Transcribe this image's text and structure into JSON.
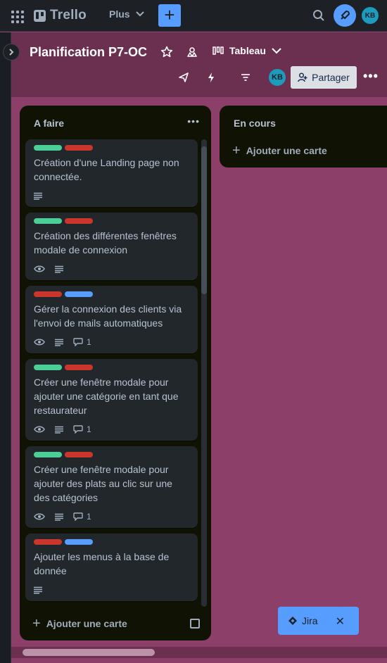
{
  "topnav": {
    "app_name": "Trello",
    "plus_label": "Plus",
    "create_label": "+",
    "avatar_initials": "KB"
  },
  "board": {
    "title": "Planification P7-OC",
    "view_label": "Tableau",
    "share_label": "Partager",
    "more_label": "•••",
    "member_initials": "KB",
    "background_color": "#8c3f68"
  },
  "lists": [
    {
      "title": "A faire",
      "more_label": "•••",
      "add_card_label": "Ajouter une carte",
      "cards": [
        {
          "labels": [
            "#4bce97",
            "#c9372c"
          ],
          "title": "Création d'une Landing page non connectée.",
          "has_watch": false,
          "has_description": true,
          "comments": ""
        },
        {
          "labels": [
            "#4bce97",
            "#c9372c"
          ],
          "title": "Création des différentes fenêtres modale de connexion",
          "has_watch": true,
          "has_description": true,
          "comments": ""
        },
        {
          "labels": [
            "#c9372c",
            "#579dff"
          ],
          "title": "Gérer la connexion des clients via l'envoi de mails automatiques",
          "has_watch": true,
          "has_description": true,
          "comments": "1"
        },
        {
          "labels": [
            "#4bce97",
            "#c9372c"
          ],
          "title": "Créer une fenêtre modale pour ajouter une catégorie en tant que restaurateur",
          "has_watch": true,
          "has_description": true,
          "comments": "1"
        },
        {
          "labels": [
            "#4bce97",
            "#c9372c"
          ],
          "title": "Créer une fenêtre modale pour ajouter des plats au clic sur une des catégories",
          "has_watch": true,
          "has_description": true,
          "comments": "1"
        },
        {
          "labels": [
            "#c9372c",
            "#579dff"
          ],
          "title": "Ajouter les menus à la base de donnée",
          "has_watch": false,
          "has_description": true,
          "comments": ""
        }
      ]
    },
    {
      "title": "En cours",
      "add_card_label": "Ajouter une carte",
      "cards": []
    }
  ],
  "jira": {
    "label": "Jira",
    "close_label": "✕"
  },
  "colors": {
    "accent": "#579dff",
    "list_bg": "#101204",
    "card_bg": "#22272b",
    "label_green": "#4bce97",
    "label_red": "#c9372c",
    "label_blue": "#579dff"
  }
}
